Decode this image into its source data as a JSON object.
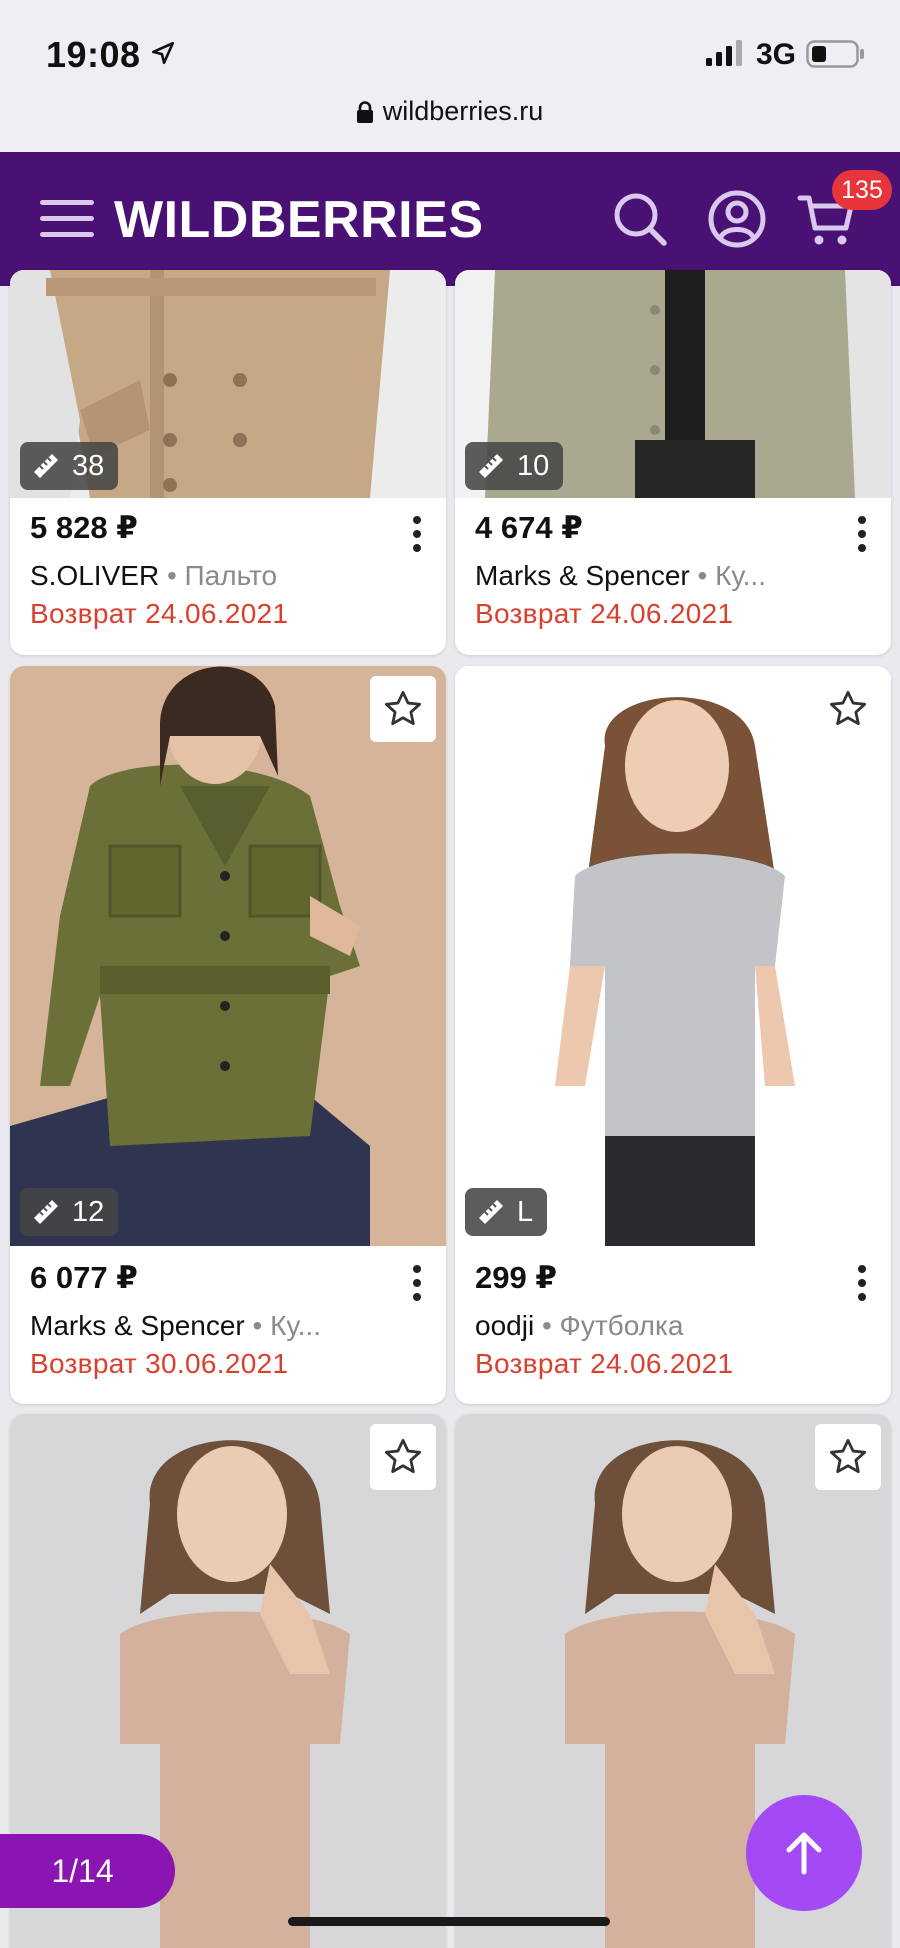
{
  "status": {
    "time": "19:08",
    "network": "3G"
  },
  "browser": {
    "url": "wildberries.ru"
  },
  "header": {
    "brand": "WILDBERRIES",
    "cart_count": "135"
  },
  "products": [
    {
      "price": "5 828 ₽",
      "brand": "S.OLIVER",
      "category": "Пальто",
      "return_text": "Возврат 24.06.2021",
      "size_badge": "38",
      "favorite": false
    },
    {
      "price": "4 674 ₽",
      "brand": "Marks & Spencer",
      "category": "Ку...",
      "return_text": "Возврат 24.06.2021",
      "size_badge": "10",
      "favorite": false
    },
    {
      "price": "6 077 ₽",
      "brand": "Marks & Spencer",
      "category": "Ку...",
      "return_text": "Возврат 30.06.2021",
      "size_badge": "12",
      "favorite": true
    },
    {
      "price": "299 ₽",
      "brand": "oodji",
      "category": "Футболка",
      "return_text": "Возврат 24.06.2021",
      "size_badge": "L",
      "favorite": true
    },
    {
      "favorite": true
    },
    {
      "favorite": true
    }
  ],
  "pager": {
    "label": "1/14"
  },
  "colors": {
    "header": "#481173",
    "accent": "#a44af5",
    "pager": "#8a15b2",
    "return": "#d9412f",
    "badge": "#e7353b"
  }
}
